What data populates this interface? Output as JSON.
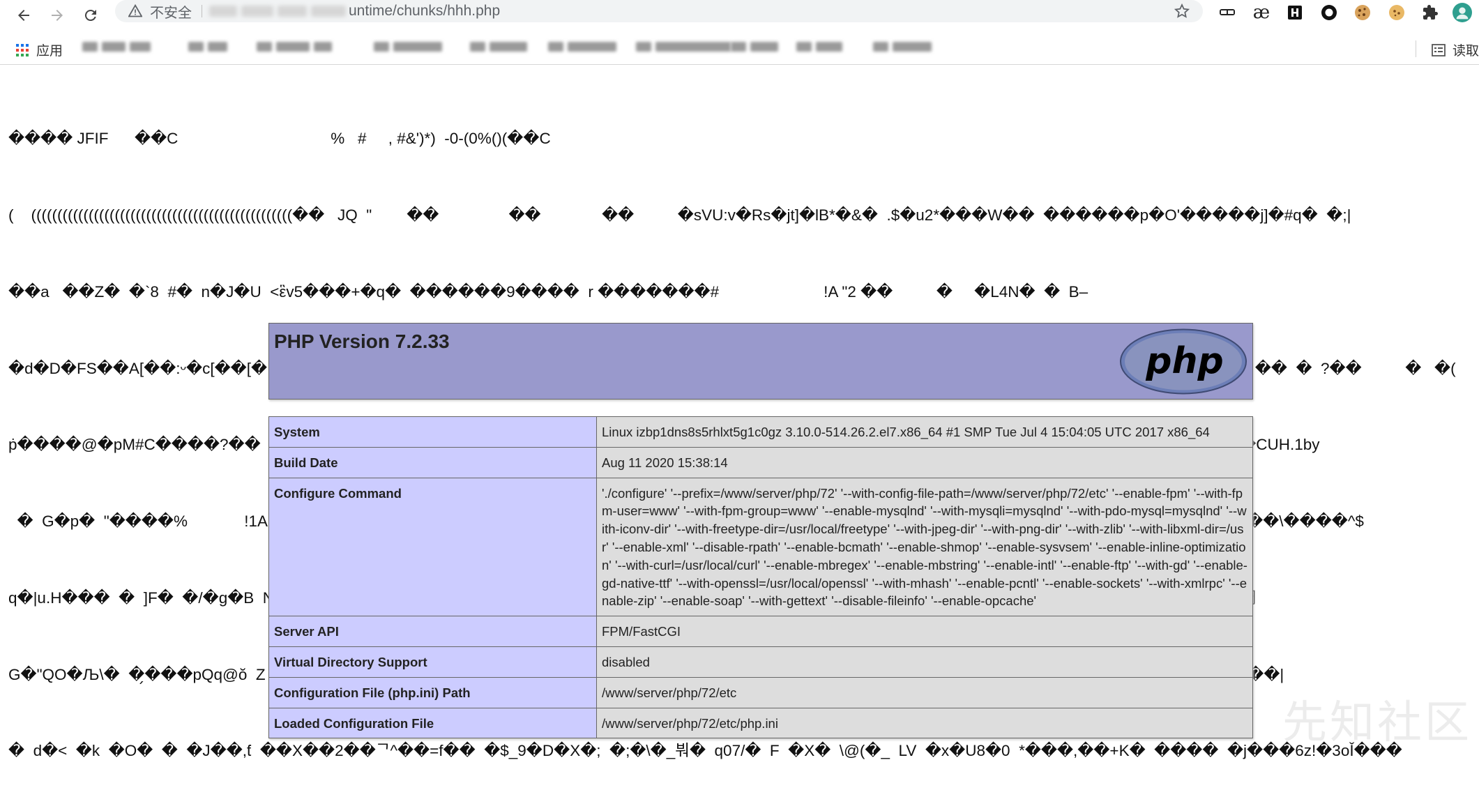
{
  "browser": {
    "insecure_label": "不安全",
    "url_visible": "untime/chunks/hhh.php"
  },
  "bookmarks": {
    "apps_label": "应用",
    "reading_list_label": "读取"
  },
  "garbage_lines": [
    "���� JFIF      ��C                                   %   #     , #&')*)  -0-(0%()(��C",
    "(    ((((((((((((((((((((((((((((((((((((((((((((((((((��   JQ  \"        ��                ��              ��          �sVU:v�Rs�jt]�lB*�&�  .$�u2*���W��  ������p�O'�����j]�#q�  �;|",
    "��a   ��Z�  �`8  #�  n�J�U  <ἓv5���+�q�  ������9����  r �������#                        !A \"2 ��          �     �L4N�  �  B–",
    "�d�D�FS��A[��:ᵕ�c[��[�  �ᵹ���k���M��l�,k��  �$�,I  l�8  ��  Ș  J  �^�tJh��  >t!C  �  J���  C~  K   �>LHy�������h��Q–��\";  ��  �  ?��          �   �(",
    "ṗ����@�pM#C����?��          !A 1Qq���      ?   x���  ^�`��   s���FHtS  �  �  �&6ǯ�  cT5  0��  f�Z�Z+y|���          !1Q��        ? ,�     2�ﻪ�CUH.1by",
    "  �  G�p�  \"����%             !1AQaq��  ���������      ?  ���3  0M�p��7x�:��sP��$^����#�r��lV��  ������   w^��  �|\"Ÿa��G��\\����^$",
    "q�|u.H���  �  ]F�  �/�g�B  N�E�h��ˇ���<��  C?1�  ��S%A����(  cvN���|�  �!Jf�#��     �'  �_  �  �  [���2��Y��'2�%vE|7��s,鯛",
    "G�\"QO�Љ\\�  �̗���pQq@ŏ  Z  F���4�?M�  �A�%�����Q  o��v�7  /  T�]~�8H  �;eN�>  ��    �A��q�6�|K���i�!�  �K�]Vs�  ����  ��|",
    "�  d�<  �k  �O�  �  �J��,ƭ  ��X��2��ᄀ^��=f��  �$_9�D�X�;  �;�\\�_붜�  q07/�  F  �X�  \\@(�_  LV  �x�U8�0  *���,��+K�  ����  �j���6z!�3oǏ���"
  ],
  "phpinfo": {
    "title": "PHP Version 7.2.33",
    "logo_text": "php",
    "rows": [
      {
        "key": "System",
        "value": "Linux izbp1dns8s5rhlxt5g1c0gz 3.10.0-514.26.2.el7.x86_64 #1 SMP Tue Jul 4 15:04:05 UTC 2017 x86_64"
      },
      {
        "key": "Build Date",
        "value": "Aug 11 2020 15:38:14"
      },
      {
        "key": "Configure Command",
        "value": "'./configure' '--prefix=/www/server/php/72' '--with-config-file-path=/www/server/php/72/etc' '--enable-fpm' '--with-fpm-user=www' '--with-fpm-group=www' '--enable-mysqlnd' '--with-mysqli=mysqlnd' '--with-pdo-mysql=mysqlnd' '--with-iconv-dir' '--with-freetype-dir=/usr/local/freetype' '--with-jpeg-dir' '--with-png-dir' '--with-zlib' '--with-libxml-dir=/usr' '--enable-xml' '--disable-rpath' '--enable-bcmath' '--enable-shmop' '--enable-sysvsem' '--enable-inline-optimization' '--with-curl=/usr/local/curl' '--enable-mbregex' '--enable-mbstring' '--enable-intl' '--enable-ftp' '--with-gd' '--enable-gd-native-ttf' '--with-openssl=/usr/local/openssl' '--with-mhash' '--enable-pcntl' '--enable-sockets' '--with-xmlrpc' '--enable-zip' '--enable-soap' '--with-gettext' '--disable-fileinfo' '--enable-opcache'"
      },
      {
        "key": "Server API",
        "value": "FPM/FastCGI"
      },
      {
        "key": "Virtual Directory Support",
        "value": "disabled"
      },
      {
        "key": "Configuration File (php.ini) Path",
        "value": "/www/server/php/72/etc"
      },
      {
        "key": "Loaded Configuration File",
        "value": "/www/server/php/72/etc/php.ini"
      }
    ]
  },
  "watermark": "先知社区",
  "colors": {
    "php_header_bg": "#9999cc",
    "key_cell_bg": "#ccccff",
    "value_cell_bg": "#dddddd"
  },
  "icons": [
    "back-arrow-icon",
    "forward-arrow-icon",
    "reload-icon",
    "warning-icon",
    "star-icon",
    "extension-icons",
    "apps-grid-icon",
    "reading-list-icon"
  ]
}
